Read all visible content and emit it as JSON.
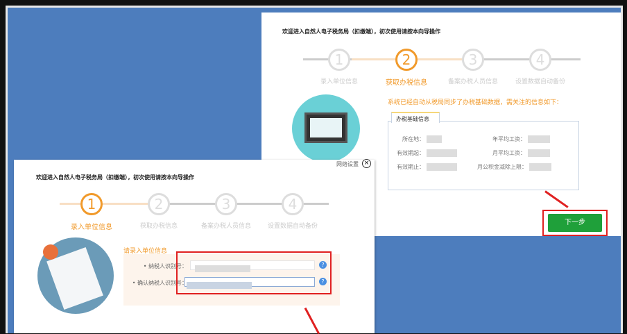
{
  "back_window": {
    "title": "欢迎进入自然人电子税务局（扣缴端），初次使用请按本向导操作",
    "steps": [
      {
        "num": "1",
        "label": "录入单位信息"
      },
      {
        "num": "2",
        "label": "获取办税信息"
      },
      {
        "num": "3",
        "label": "备案办税人员信息"
      },
      {
        "num": "4",
        "label": "设置数据自动备份"
      }
    ],
    "active_step": 2,
    "notice": "系统已经自动从税局同步了办税基础数据，需关注的信息如下：",
    "info_tab": "办税基础信息",
    "fields": {
      "location": "所在地：",
      "valid_from": "有效期起：",
      "valid_to": "有效期止：",
      "annual_wage": "年平均工资：",
      "monthly_wage": "月平均工资：",
      "fund_limit": "月公积金减除上限："
    },
    "network_settings": "网络设置",
    "next_button": "下一步"
  },
  "front_window": {
    "title": "欢迎进入自然人电子税务局（扣缴端），初次使用请按本向导操作",
    "steps": [
      {
        "num": "1",
        "label": "录入单位信息"
      },
      {
        "num": "2",
        "label": "获取办税信息"
      },
      {
        "num": "3",
        "label": "备案办税人员信息"
      },
      {
        "num": "4",
        "label": "设置数据自动备份"
      }
    ],
    "active_step": 1,
    "section_title": "请录入单位信息",
    "taxpayer_id_label": "• 纳税人识别号：",
    "confirm_id_label": "• 确认纳税人识别号：",
    "help": "?"
  }
}
